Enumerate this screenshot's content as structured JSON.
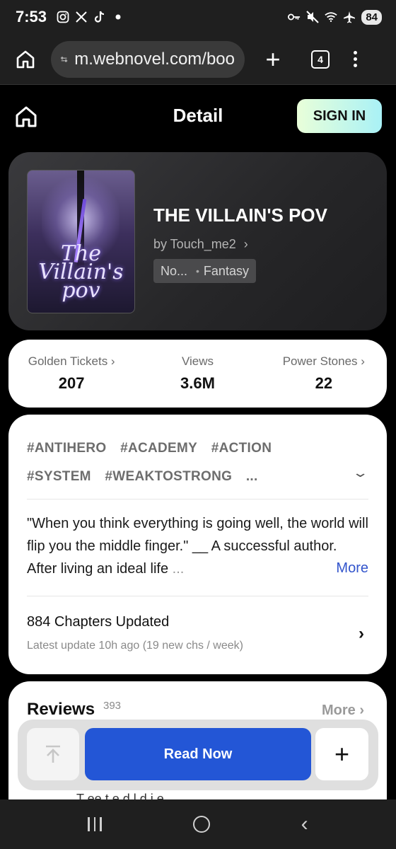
{
  "status_bar": {
    "time": "7:53",
    "battery": "84",
    "left_icons": [
      "instagram-icon",
      "x-icon",
      "tiktok-icon",
      "dot-icon"
    ],
    "right_icons": [
      "key-icon",
      "mute-icon",
      "wifi-icon",
      "airplane-icon"
    ]
  },
  "browser": {
    "url": "m.webnovel.com/boo",
    "tab_count": "4"
  },
  "header": {
    "title": "Detail",
    "sign_in": "SIGN IN"
  },
  "book": {
    "title": "THE VILLAIN'S POV",
    "author": "by Touch_me2",
    "author_arrow": "›",
    "tag_primary": "No...",
    "tag_genre": "Fantasy",
    "cover_text": "The Villain's pov"
  },
  "stats": [
    {
      "label": "Golden Tickets ›",
      "value": "207"
    },
    {
      "label": "Views",
      "value": "3.6M"
    },
    {
      "label": "Power Stones ›",
      "value": "22"
    }
  ],
  "tags": [
    "#ANTIHERO",
    "#ACADEMY",
    "#ACTION",
    "#SYSTEM",
    "#WEAKTOSTRONG",
    "..."
  ],
  "synopsis": {
    "text": "\"When you think everything is going well, the world will flip you the middle finger.\" __ A successful author. After living an ideal life",
    "ellipsis": "...",
    "more": "More"
  },
  "chapters": {
    "title": "884 Chapters Updated",
    "subtitle": "Latest update 10h ago (19 new chs / week)"
  },
  "reviews": {
    "title": "Reviews",
    "count": "393",
    "more": "More ›",
    "peek": "T   ee   t      e  d   l    d  i   e"
  },
  "actions": {
    "read_now": "Read Now",
    "add": "+"
  },
  "colors": {
    "accent_blue": "#2356d6",
    "sign_in_gradient_start": "#e9ffd9",
    "sign_in_gradient_end": "#a9f1f6",
    "more_link": "#3355cc"
  }
}
